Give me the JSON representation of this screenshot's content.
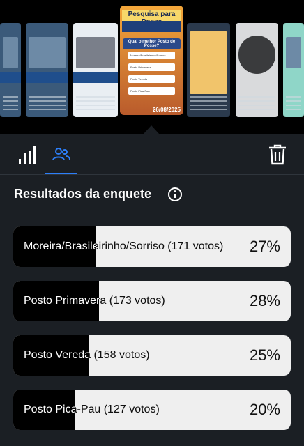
{
  "story": {
    "title": "Pesquisa para Posse",
    "question": "Qual o melhor Posto de Posse?",
    "options": [
      "Moreira/Brasileirinho/Sorriso",
      "Posto Primavera",
      "Posto Vereda",
      "Posto Pica-Pau"
    ],
    "date": "26/08/2025"
  },
  "tabs": {
    "insights_icon": "bar-chart-icon",
    "viewers_icon": "people-icon",
    "delete_icon": "trash-icon"
  },
  "poll": {
    "heading": "Resultados da enquete",
    "info_icon": "info-icon",
    "results": [
      {
        "label": "Moreira/Brasileirinho/Sorriso (171 votos)",
        "percent": "27%",
        "value": 0.27
      },
      {
        "label": "Posto Primavera (173 votos)",
        "percent": "28%",
        "value": 0.28
      },
      {
        "label": "Posto Vereda (158 votos)",
        "percent": "25%",
        "value": 0.25
      },
      {
        "label": "Posto Pica-Pau (127 votos)",
        "percent": "20%",
        "value": 0.2
      }
    ]
  },
  "colors": {
    "panel_bg": "#1b1f24",
    "accent": "#2d7ff9",
    "bar_bg": "#efefef",
    "bar_fill": "#000000"
  }
}
